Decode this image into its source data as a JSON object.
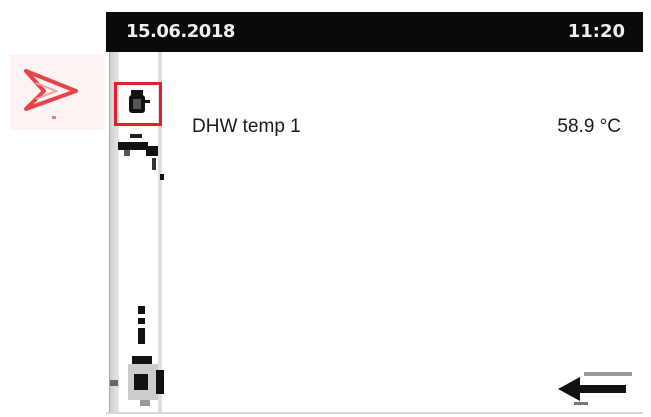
{
  "status_bar": {
    "date": "15.06.2018",
    "time": "11:20"
  },
  "main": {
    "items": [
      {
        "label": "DHW temp 1",
        "value": "58.9 °C"
      }
    ]
  },
  "icons": {
    "pointer": "pointer-arrow-icon",
    "selected": "dhw-tank-icon",
    "tap": "tap-water-icon",
    "temperature": "thermometer-icon",
    "pump": "pump-icon",
    "back": "back-arrow-icon"
  },
  "colors": {
    "status_bar_bg": "#0a0a0a",
    "selection": "#e0202a",
    "pointer": "#e8434a"
  }
}
